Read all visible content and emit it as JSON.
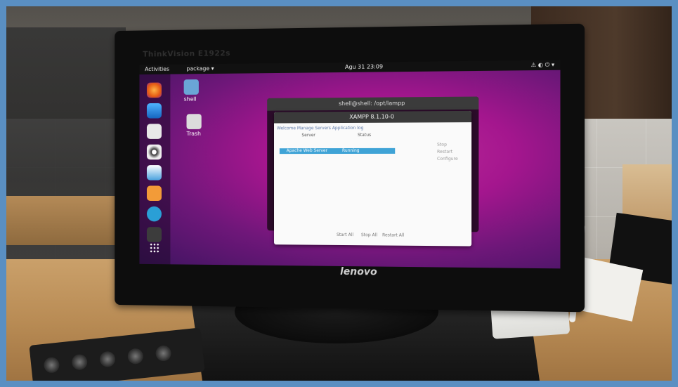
{
  "monitor": {
    "brand_top": "ThinkVision E1922s",
    "brand_bottom": "lenovo"
  },
  "desktop": {
    "topbar": {
      "activities": "Activities",
      "package_menu": "package ▾",
      "clock": "Agu 31  23:09",
      "tray": "⚠ ◐ ⏻ ▾"
    },
    "icons": [
      {
        "label": "shell",
        "icon": "folder-icon"
      },
      {
        "label": "Trash",
        "icon": "trash-icon"
      }
    ],
    "dock": [
      "firefox-icon",
      "thunderbird-icon",
      "files-icon",
      "rhythmbox-icon",
      "libreoffice-icon",
      "software-icon",
      "help-icon",
      "terminal-icon"
    ],
    "terminal_title": "shell@shell: /opt/lampp",
    "xampp": {
      "title": "XAMPP 8.1.10-0",
      "tabs": "Welcome  Manage Servers  Application log",
      "col_server": "Server",
      "col_status": "Status",
      "row_server": "Apache Web Server",
      "row_status": "Running",
      "side_actions": [
        "Stop",
        "Restart",
        "Configure"
      ],
      "footer_actions": [
        "Start All",
        "Stop All",
        "Restart All"
      ]
    }
  },
  "accent": "#a4168e"
}
